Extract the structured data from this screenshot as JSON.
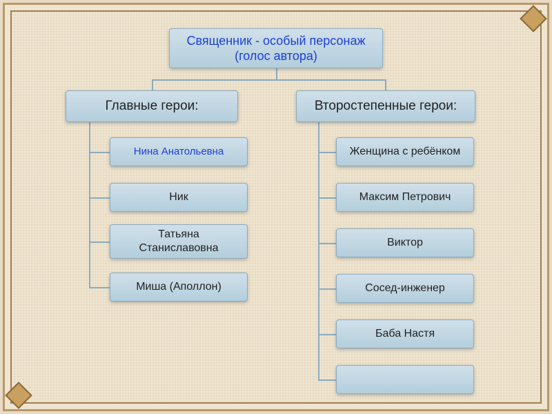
{
  "root": {
    "line1": "Священник - особый персонаж",
    "line2": "(голос автора)"
  },
  "categories": {
    "main": {
      "title": "Главные герои:"
    },
    "secondary": {
      "title": "Второстепенные герои:"
    }
  },
  "main_heroes": [
    {
      "line1": "Нина Анатольевна"
    },
    {
      "line1": "Ник"
    },
    {
      "line1": "Татьяна",
      "line2": "Станиславовна"
    },
    {
      "line1": "Миша (Аполлон)"
    }
  ],
  "secondary_heroes": [
    {
      "line1": "Женщина с ребёнком"
    },
    {
      "line1": "Максим Петрович"
    },
    {
      "line1": "Виктор"
    },
    {
      "line1": "Сосед-инженер"
    },
    {
      "line1": "Баба Настя"
    },
    {
      "line1": ""
    }
  ],
  "colors": {
    "node_gradient_top": "#d0e0ea",
    "node_gradient_bottom": "#b4cedc",
    "node_border": "#8aaabf",
    "accent_blue": "#1a3fd6",
    "background": "#f0e6d2",
    "frame": "#b89968"
  }
}
